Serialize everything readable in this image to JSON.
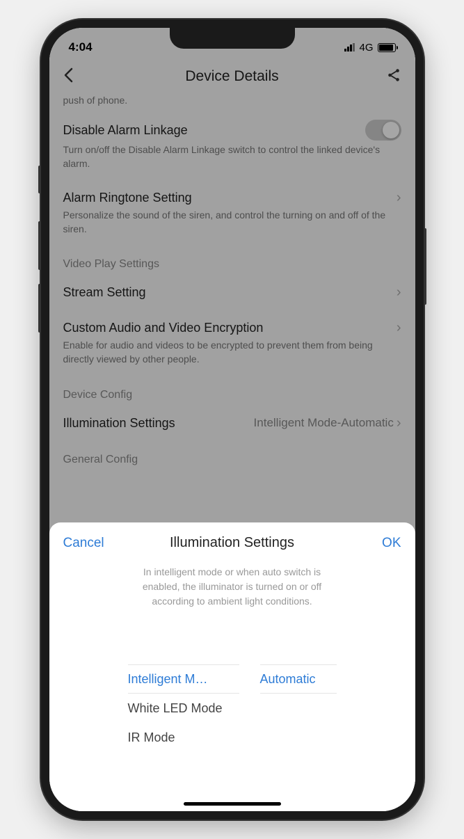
{
  "status": {
    "time": "4:04",
    "network": "4G"
  },
  "header": {
    "title": "Device Details"
  },
  "fragment": "push of phone.",
  "rows": {
    "disable_alarm": {
      "title": "Disable Alarm Linkage",
      "sub": "Turn on/off the Disable Alarm Linkage switch to control the linked device's alarm."
    },
    "ringtone": {
      "title": "Alarm Ringtone Setting",
      "sub": "Personalize the sound of the siren, and control the turning on and off of the siren."
    },
    "stream": {
      "title": "Stream Setting"
    },
    "encryption": {
      "title": "Custom Audio and Video Encryption",
      "sub": "Enable for audio and videos to be encrypted to prevent them from being directly viewed by other people."
    },
    "illumination": {
      "title": "Illumination Settings",
      "value": "Intelligent Mode-Automatic"
    }
  },
  "sections": {
    "video": "Video Play Settings",
    "device": "Device Config",
    "general": "General Config"
  },
  "sheet": {
    "cancel": "Cancel",
    "ok": "OK",
    "title": "Illumination Settings",
    "desc": "In intelligent mode or when auto switch is enabled, the illuminator is turned on or off according to ambient light conditions.",
    "col1": {
      "sel": "Intelligent M…",
      "opt2": "White LED Mode",
      "opt3": "IR Mode"
    },
    "col2": {
      "sel": "Automatic"
    }
  }
}
